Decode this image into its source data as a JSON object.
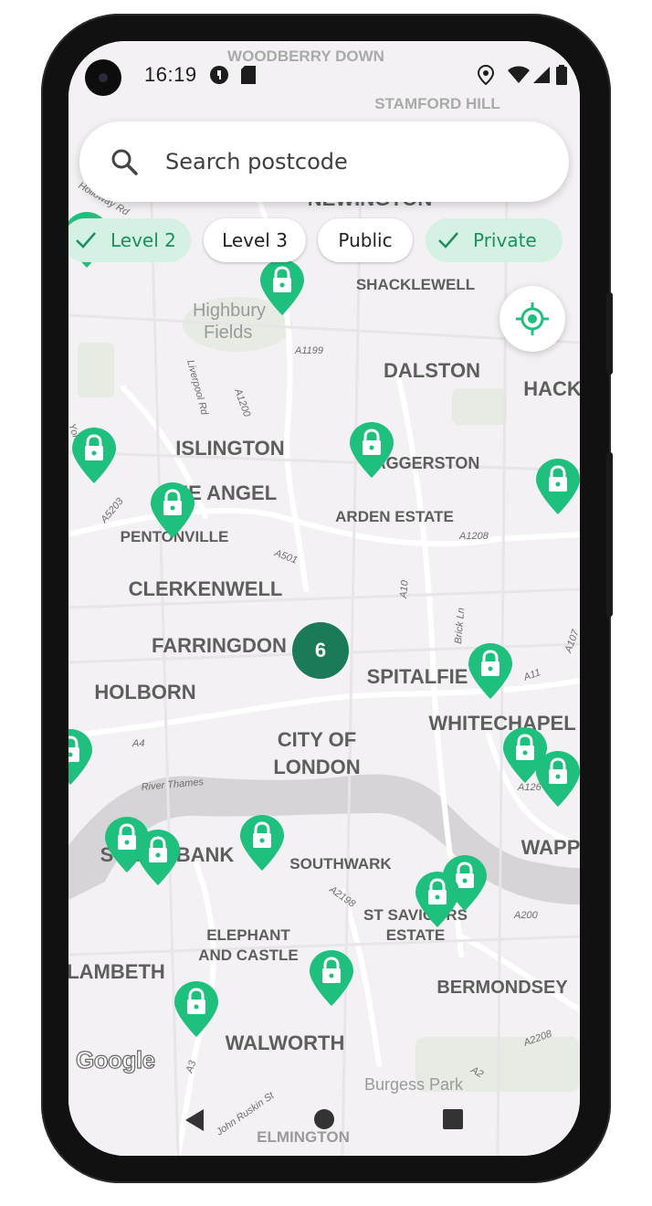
{
  "status_bar": {
    "time": "16:19"
  },
  "search": {
    "placeholder": "Search postcode"
  },
  "filters": [
    {
      "label": "Level 2",
      "selected": true
    },
    {
      "label": "Level 3",
      "selected": false
    },
    {
      "label": "Public",
      "selected": false
    },
    {
      "label": "Private",
      "selected": true
    }
  ],
  "map": {
    "attribution": "Google",
    "cluster_count": "6",
    "labels": {
      "woodberry_down": "WOODBERRY DOWN",
      "stamford_hill": "STAMFORD HILL",
      "newington": "NEWINGTON",
      "shacklewell": "SHACKLEWELL",
      "highbury_fields": "Highbury Fields",
      "dalston": "DALSTON",
      "hackney": "HACK",
      "islington": "ISLINGTON",
      "haggerston": "HAGGERSTON",
      "the_angel": "THE ANGEL",
      "arden_estate": "ARDEN ESTATE",
      "pentonville": "PENTONVILLE",
      "clerkenwell": "CLERKENWELL",
      "farringdon": "FARRINGDON",
      "spitalfields": "SPITALFIE",
      "holborn": "HOLBORN",
      "whitechapel": "WHITECHAPEL",
      "city_of_london_1": "CITY OF",
      "city_of_london_2": "LONDON",
      "south_bank": "SOUTH BANK",
      "southwark": "SOUTHWARK",
      "wapping": "WAPP",
      "st_saviours_1": "ST SAVIOURS",
      "st_saviours_2": "ESTATE",
      "elephant_1": "ELEPHANT",
      "elephant_2": "AND CASTLE",
      "lambeth": "LAMBETH",
      "bermondsey": "BERMONDSEY",
      "walworth": "WALWORTH",
      "burgess_park": "Burgess Park",
      "elmington": "ELMINGTON",
      "road_a1199": "A1199",
      "road_a1200": "A1200",
      "road_liverpool": "Liverpool Rd",
      "road_a5203": "A5203",
      "road_a501": "A501",
      "road_a1208": "A1208",
      "road_a10": "A10",
      "road_brick": "Brick Ln",
      "road_a11": "A11",
      "road_a107": "A107",
      "road_a4": "A4",
      "river": "River Thames",
      "road_a2198": "A2198",
      "road_a200": "A200",
      "road_a2208": "A2208",
      "road_a3": "A3",
      "road_a2": "A2",
      "road_holloway": "Holloway Rd",
      "road_york": "York",
      "road_john_ruskin": "John Ruskin St",
      "road_a126": "A126"
    }
  },
  "colors": {
    "accent": "#1fbf7e",
    "cluster": "#1b7a58",
    "chip_selected_bg": "#d4f1e4",
    "chip_selected_text": "#1b8f62"
  }
}
